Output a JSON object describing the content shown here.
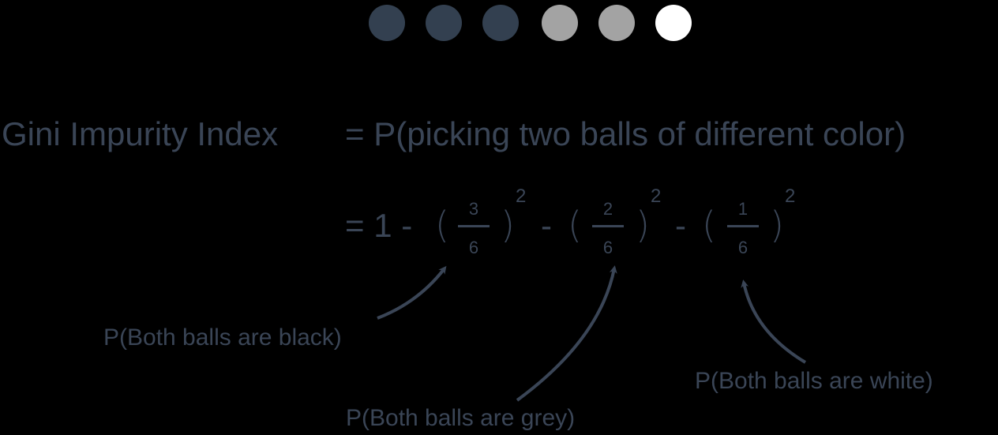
{
  "colors": {
    "background": "#000000",
    "text": "#3a4556",
    "black_ball": "#334050",
    "grey_ball": "#a3a3a3",
    "white_ball": "#ffffff"
  },
  "balls": [
    {
      "color_name": "black"
    },
    {
      "color_name": "black"
    },
    {
      "color_name": "black"
    },
    {
      "color_name": "grey"
    },
    {
      "color_name": "grey"
    },
    {
      "color_name": "white"
    }
  ],
  "equation": {
    "lhs": "Gini Impurity Index",
    "rhs_line1": "= P(picking two balls of different color)",
    "rhs_line2_prefix": "= 1 -",
    "minus": "-",
    "open_paren": "(",
    "close_paren": ")",
    "terms": [
      {
        "numerator": "3",
        "denominator": "6",
        "exponent": "2"
      },
      {
        "numerator": "2",
        "denominator": "6",
        "exponent": "2"
      },
      {
        "numerator": "1",
        "denominator": "6",
        "exponent": "2"
      }
    ]
  },
  "annotations": {
    "black": "P(Both balls are black)",
    "grey": "P(Both balls are grey)",
    "white": "P(Both balls are white)"
  }
}
